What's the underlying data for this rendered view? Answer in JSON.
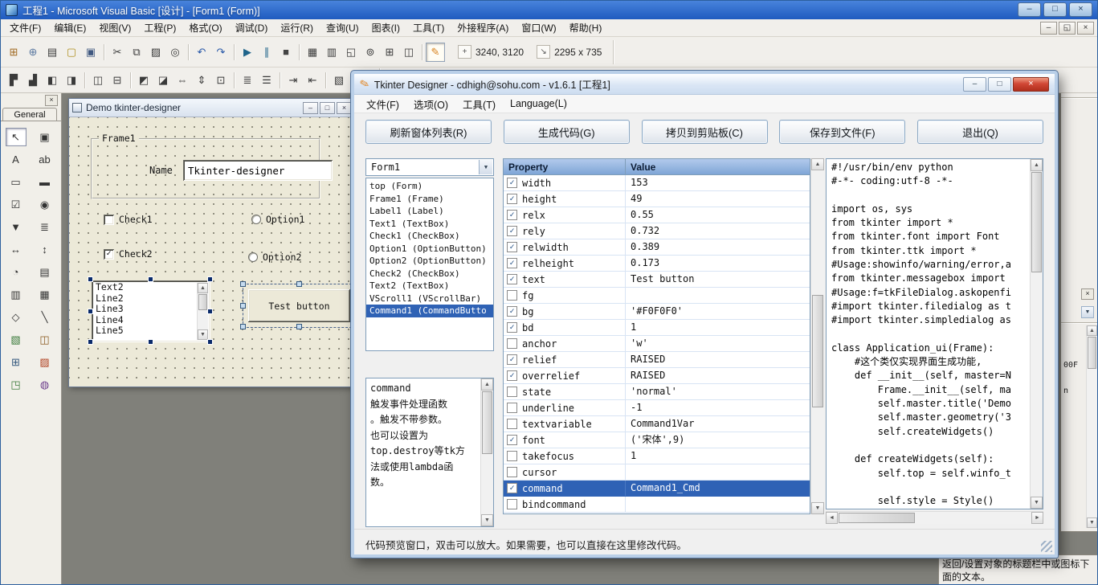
{
  "main_window": {
    "title": "工程1 - Microsoft Visual Basic [设计] - [Form1 (Form)]",
    "menus": [
      "文件(F)",
      "编辑(E)",
      "视图(V)",
      "工程(P)",
      "格式(O)",
      "调试(D)",
      "运行(R)",
      "查询(U)",
      "图表(I)",
      "工具(T)",
      "外接程序(A)",
      "窗口(W)",
      "帮助(H)"
    ],
    "toolbar1_icons": [
      {
        "name": "add-project",
        "glyph": "⊞",
        "color": "#a06820"
      },
      {
        "name": "add-form",
        "glyph": "⊕",
        "color": "#5a78a0"
      },
      {
        "name": "menu-editor",
        "glyph": "▤"
      },
      {
        "name": "open-project",
        "glyph": "▢",
        "color": "#b09020"
      },
      {
        "name": "save-project",
        "glyph": "▣",
        "color": "#405880"
      },
      {
        "sep": true
      },
      {
        "name": "cut",
        "glyph": "✂"
      },
      {
        "name": "copy",
        "glyph": "⧉"
      },
      {
        "name": "paste",
        "glyph": "▨"
      },
      {
        "name": "find",
        "glyph": "◎"
      },
      {
        "sep": true
      },
      {
        "name": "undo",
        "glyph": "↶",
        "color": "#2858a8"
      },
      {
        "name": "redo",
        "glyph": "↷",
        "color": "#2858a8"
      },
      {
        "sep": true
      },
      {
        "name": "start",
        "glyph": "▶",
        "color": "#20648a"
      },
      {
        "name": "break",
        "glyph": "∥",
        "color": "#20648a"
      },
      {
        "name": "end",
        "glyph": "■",
        "color": "#444444"
      },
      {
        "sep": true
      },
      {
        "name": "project-explorer",
        "glyph": "▦"
      },
      {
        "name": "properties-window",
        "glyph": "▥"
      },
      {
        "name": "form-layout-window",
        "glyph": "◱"
      },
      {
        "name": "object-browser",
        "glyph": "⊚"
      },
      {
        "name": "toolbox-window",
        "glyph": "⊞"
      },
      {
        "name": "data-view-window",
        "glyph": "◫"
      },
      {
        "sep": true
      },
      {
        "name": "tkinter-designer-addin",
        "glyph": "✎",
        "color": "#d8821e",
        "pressed": true
      }
    ],
    "position_readout": "3240, 3120",
    "size_readout": "2295 x 735",
    "toolbar2_icons": [
      {
        "name": "bring-to-front",
        "glyph": "▛"
      },
      {
        "name": "send-to-back",
        "glyph": "▟"
      },
      {
        "name": "align-lefts",
        "glyph": "◧"
      },
      {
        "name": "align-rights",
        "glyph": "◨"
      },
      {
        "sep": true
      },
      {
        "name": "center-horizontally",
        "glyph": "◫"
      },
      {
        "name": "center-vertically",
        "glyph": "⊟"
      },
      {
        "sep": true
      },
      {
        "name": "align-tops",
        "glyph": "◩"
      },
      {
        "name": "align-bottoms",
        "glyph": "◪"
      },
      {
        "name": "same-width",
        "glyph": "⇔"
      },
      {
        "name": "same-height",
        "glyph": "⇕"
      },
      {
        "name": "same-size",
        "glyph": "⊡"
      },
      {
        "sep": true
      },
      {
        "name": "bullet-list",
        "glyph": "≣"
      },
      {
        "name": "numbered-list",
        "glyph": "☰"
      },
      {
        "sep": true
      },
      {
        "name": "indent",
        "glyph": "⇥"
      },
      {
        "name": "outdent",
        "glyph": "⇤"
      },
      {
        "sep": true
      },
      {
        "name": "comment-block",
        "glyph": "▧"
      },
      {
        "name": "bookmark",
        "glyph": "◈"
      }
    ]
  },
  "toolbox": {
    "tab_label": "General",
    "tools": [
      {
        "name": "pointer",
        "glyph": "↖",
        "pressed": true
      },
      {
        "name": "picture-box",
        "glyph": "▣"
      },
      {
        "name": "label",
        "glyph": "A"
      },
      {
        "name": "text-box",
        "glyph": "ab"
      },
      {
        "name": "frame",
        "glyph": "▭"
      },
      {
        "name": "command-button",
        "glyph": "▬"
      },
      {
        "name": "check-box",
        "glyph": "☑"
      },
      {
        "name": "option-button",
        "glyph": "◉"
      },
      {
        "name": "combo-box",
        "glyph": "▼"
      },
      {
        "name": "list-box",
        "glyph": "≣"
      },
      {
        "name": "h-scrollbar",
        "glyph": "↔"
      },
      {
        "name": "v-scrollbar",
        "glyph": "↕"
      },
      {
        "name": "timer",
        "glyph": "◔"
      },
      {
        "name": "drive-listbox",
        "glyph": "▤"
      },
      {
        "name": "dir-listbox",
        "glyph": "▥"
      },
      {
        "name": "file-listbox",
        "glyph": "▦"
      },
      {
        "name": "shape",
        "glyph": "◇"
      },
      {
        "name": "line",
        "glyph": "╲"
      },
      {
        "name": "image",
        "glyph": "▧",
        "color": "#3a7a3a"
      },
      {
        "name": "data",
        "glyph": "◫",
        "color": "#8a5a20"
      },
      {
        "name": "ole",
        "glyph": "⊞",
        "color": "#35597e"
      },
      {
        "name": "rich-text-box",
        "glyph": "▨",
        "color": "#b04020"
      },
      {
        "name": "common-dialog",
        "glyph": "◳",
        "color": "#3a7a3a"
      },
      {
        "name": "custom-control",
        "glyph": "◍",
        "color": "#6a3a8a"
      }
    ]
  },
  "form_designer": {
    "title": "Demo tkinter-designer",
    "frame1": {
      "caption": "Frame1",
      "name_label": "Name",
      "name_value": "Tkinter-designer"
    },
    "check1_label": "Check1",
    "check2_label": "Check2",
    "option1_label": "Option1",
    "option2_label": "Option2",
    "listbox_items": [
      "Text2",
      "Line2",
      "Line3",
      "Line4",
      "Line5"
    ],
    "button_label": "Test button"
  },
  "dialog": {
    "title": "Tkinter Designer - cdhigh@sohu.com - v1.6.1 [工程1]",
    "menus": [
      "文件(F)",
      "选项(O)",
      "工具(T)",
      "Language(L)"
    ],
    "action_buttons": [
      "刷新窗体列表(R)",
      "生成代码(G)",
      "拷贝到剪贴板(C)",
      "保存到文件(F)",
      "退出(Q)"
    ],
    "form_selector": "Form1",
    "widgets": [
      {
        "label": "top (Form)"
      },
      {
        "label": "Frame1 (Frame)"
      },
      {
        "label": "Label1 (Label)"
      },
      {
        "label": "Text1 (TextBox)"
      },
      {
        "label": "Check1 (CheckBox)"
      },
      {
        "label": "Option1 (OptionButton)"
      },
      {
        "label": "Option2 (OptionButton)"
      },
      {
        "label": "Check2 (CheckBox)"
      },
      {
        "label": "Text2 (TextBox)"
      },
      {
        "label": "VScroll1 (VScrollBar)"
      },
      {
        "label": "Command1 (CommandButto",
        "selected": true
      }
    ],
    "property_help_lines": [
      "command",
      "触发事件处理函数",
      "。触发不带参数。",
      "也可以设置为",
      "top.destroy等tk方",
      "法或使用lambda函",
      "数。"
    ],
    "grid": {
      "property_header": "Property",
      "value_header": "Value",
      "rows": [
        {
          "checked": true,
          "property": "width",
          "value": "153"
        },
        {
          "checked": true,
          "property": "height",
          "value": "49"
        },
        {
          "checked": true,
          "property": "relx",
          "value": "0.55"
        },
        {
          "checked": true,
          "property": "rely",
          "value": "0.732"
        },
        {
          "checked": true,
          "property": "relwidth",
          "value": "0.389"
        },
        {
          "checked": true,
          "property": "relheight",
          "value": "0.173"
        },
        {
          "checked": true,
          "property": "text",
          "value": "Test button"
        },
        {
          "checked": false,
          "property": "fg",
          "value": ""
        },
        {
          "checked": true,
          "property": "bg",
          "value": "'#F0F0F0'"
        },
        {
          "checked": true,
          "property": "bd",
          "value": "1"
        },
        {
          "checked": false,
          "property": "anchor",
          "value": "'w'"
        },
        {
          "checked": true,
          "property": "relief",
          "value": "RAISED"
        },
        {
          "checked": true,
          "property": "overrelief",
          "value": "RAISED"
        },
        {
          "checked": false,
          "property": "state",
          "value": "'normal'"
        },
        {
          "checked": false,
          "property": "underline",
          "value": "-1"
        },
        {
          "checked": false,
          "property": "textvariable",
          "value": "Command1Var"
        },
        {
          "checked": true,
          "property": "font",
          "value": "('宋体',9)"
        },
        {
          "checked": false,
          "property": "takefocus",
          "value": "1"
        },
        {
          "checked": false,
          "property": "cursor",
          "value": ""
        },
        {
          "checked": true,
          "property": "command",
          "value": "Command1_Cmd",
          "selected": true
        },
        {
          "checked": false,
          "property": "bindcommand",
          "value": ""
        }
      ]
    },
    "code_lines": [
      "#!/usr/bin/env python",
      "#-*- coding:utf-8 -*-",
      "",
      "import os, sys",
      "from tkinter import *",
      "from tkinter.font import Font",
      "from tkinter.ttk import *",
      "#Usage:showinfo/warning/error,a",
      "from tkinter.messagebox import",
      "#Usage:f=tkFileDialog.askopenfi",
      "#import tkinter.filedialog as t",
      "#import tkinter.simpledialog as",
      "",
      "class Application_ui(Frame):",
      "    #这个类仅实现界面生成功能,",
      "    def __init__(self, master=N",
      "        Frame.__init__(self, ma",
      "        self.master.title('Demo",
      "        self.master.geometry('3",
      "        self.createWidgets()",
      "",
      "    def createWidgets(self):",
      "        self.top = self.winfo_t",
      "",
      "        self.style = Style()"
    ],
    "status_text": "代码预览窗口，双击可以放大。如果需要，也可以直接在这里修改代码。"
  },
  "right_panel": {
    "fragments": [
      "00F",
      "n"
    ],
    "hint_text": "返回/设置对象的标题栏中或图标下面的文本。"
  }
}
